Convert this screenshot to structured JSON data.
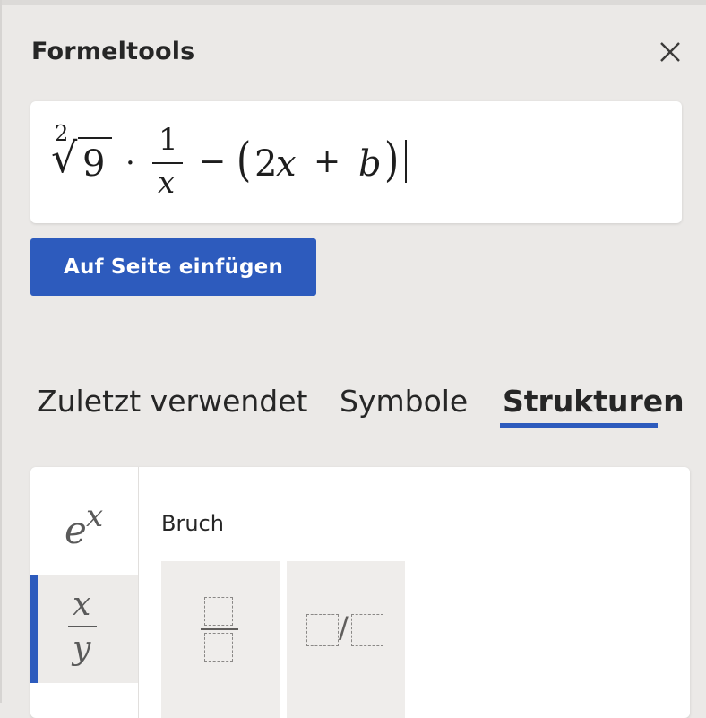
{
  "panel": {
    "title": "Formeltools"
  },
  "icons": {
    "close": "close-icon",
    "superscript": "superscript-icon",
    "fraction": "fraction-icon",
    "stacked_fraction": "stacked-fraction-icon",
    "linear_fraction": "linear-fraction-icon"
  },
  "equation": {
    "root_index": "2",
    "root_sign": "√",
    "radicand": "9",
    "dot": "·",
    "frac_numerator": "1",
    "frac_denominator": "x",
    "minus": "−",
    "open_paren": "(",
    "coef": "2",
    "var_x": "x",
    "plus": "+",
    "var_b": "b",
    "close_paren": ")"
  },
  "actions": {
    "insert_label": "Auf Seite einfügen"
  },
  "tabs": [
    {
      "label": "Zuletzt verwendet",
      "active": false
    },
    {
      "label": "Symbole",
      "active": false
    },
    {
      "label": "Strukturen",
      "active": true
    }
  ],
  "structures": {
    "sidebar": {
      "exp_base": "e",
      "exp_power": "x",
      "frac_top": "x",
      "frac_bottom": "y"
    },
    "section_label": "Bruch",
    "linear_slash": "/"
  },
  "colors": {
    "accent": "#2d5bbd",
    "background": "#ebe9e7",
    "card": "#ffffff"
  }
}
